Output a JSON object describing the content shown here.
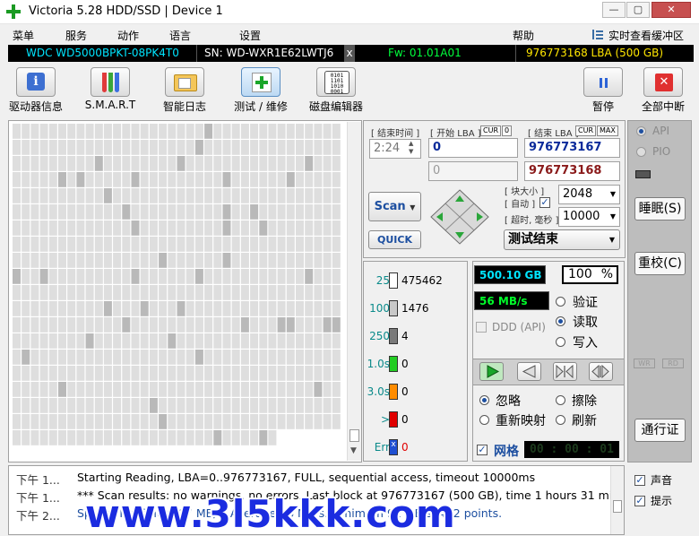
{
  "window": {
    "title": "Victoria 5.28 HDD/SSD | Device 1",
    "min_label": "—",
    "max_label": "▢",
    "close_label": "✕"
  },
  "menu": {
    "items": [
      "菜单",
      "服务",
      "动作",
      "语言",
      "设置",
      "帮助"
    ],
    "realtime": "实时查看缓冲区"
  },
  "info": {
    "model": "WDC WD5000BPKT-08PK4T0",
    "serial": "SN: WD-WXR1E62LWTJ6",
    "close": "x",
    "firmware": "Fw: 01.01A01",
    "capacity": "976773168 LBA (500 GB)"
  },
  "toolbar": [
    {
      "label": "驱动器信息",
      "icon": "info-icon"
    },
    {
      "label": "S.M.A.R.T",
      "icon": "test-tubes-icon"
    },
    {
      "label": "智能日志",
      "icon": "log-folder-icon"
    },
    {
      "label": "测试 / 维修",
      "icon": "medical-cross-icon"
    },
    {
      "label": "磁盘编辑器",
      "icon": "binary-disk-icon"
    },
    {
      "label": "暂停",
      "icon": "pause-icon"
    },
    {
      "label": "全部中断",
      "icon": "stop-icon"
    }
  ],
  "scan": {
    "end_time_label": "[ 结束时间 ]",
    "end_time": "2:24",
    "start_lba_label": "[ 开始 LBA ]",
    "cur": "CUR",
    "zero": "0",
    "end_lba_label": "[ 结束 LBA ]",
    "max": "MAX",
    "start_lba": "0",
    "end_lba": "976773167",
    "start_lba2": "0",
    "end_lba2": "976773168",
    "block_size_label": "[ 块大小 ]",
    "auto_label": "[ 自动 ]",
    "timeout_label": "[ 超时, 毫秒 ]",
    "block_size": "2048",
    "timeout": "10000",
    "scan_button": "Scan",
    "quick_button": "QUICK",
    "result": "测试结束"
  },
  "counts": [
    {
      "label": "25",
      "value": "475462",
      "color": "#ffffff"
    },
    {
      "label": "100",
      "value": "1476",
      "color": "#c8c8c8"
    },
    {
      "label": "250",
      "value": "4",
      "color": "#7a7a7a"
    },
    {
      "label": "1.0s",
      "value": "0",
      "color": "#22cc22"
    },
    {
      "label": "3.0s",
      "value": "0",
      "color": "#ff8c00"
    },
    {
      "label": ">",
      "value": "0",
      "color": "#e00000"
    },
    {
      "label": "Err",
      "value": "0",
      "color": "#1f4fd1"
    }
  ],
  "stats": {
    "size": "500.10 GB",
    "percent": "100",
    "percent_sign": "%",
    "speed": "56 MB/s",
    "ddd": "DDD (API)",
    "grid_label": "网格",
    "timer": "00 : 00 : 01"
  },
  "modes": {
    "verify": "验证",
    "read": "读取",
    "write": "写入",
    "selected": "read"
  },
  "actions": {
    "ignore": "忽略",
    "erase": "擦除",
    "remap": "重新映射",
    "refresh": "刷新",
    "selected": "ignore"
  },
  "rail": {
    "api": "API",
    "pio": "PIO",
    "sleep": "睡眠(S)",
    "reset": "重校(C)",
    "wr": "WR",
    "rd": "RD",
    "passport": "通行证"
  },
  "log": [
    {
      "time": "下午 1...",
      "msg": "Starting Reading, LBA=0..976773167, FULL, sequential access, timeout 10000ms"
    },
    {
      "time": "下午 1...",
      "msg": "*** Scan results: no warnings, no errors. Last block at 976773167 (500 GB), time 1 hours 31 minut..."
    },
    {
      "time": "下午 2...",
      "msg": "Speed: Maximum 97 MB/s. Average 86 MB/s. Minimum 92 MB/s. 422 points."
    }
  ],
  "log_options": {
    "sound": "声音",
    "hints": "提示"
  },
  "watermark": "www.3l5kkk.com",
  "colors": {
    "info_model": "#00e5ff",
    "info_serial": "#ffffff",
    "info_fw": "#00ff3c",
    "info_cap": "#ffe600",
    "accent_blue": "#1d4fa0",
    "speed_green": "#00ff2a"
  }
}
